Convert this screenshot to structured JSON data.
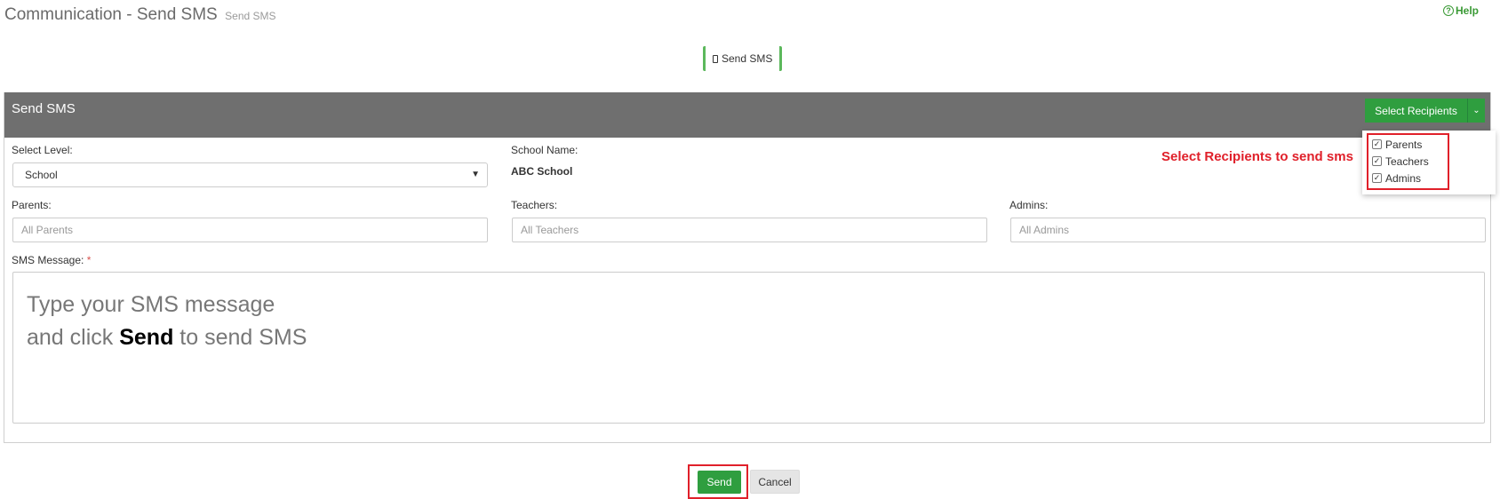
{
  "header": {
    "title": "Communication - Send SMS",
    "subtitle": "Send SMS",
    "help_label": "Help"
  },
  "tab": {
    "label": "Send SMS"
  },
  "panel": {
    "title": "Send SMS",
    "select_recipients_label": "Select Recipients"
  },
  "recipients_dropdown": {
    "items": [
      {
        "label": "Parents",
        "checked": true
      },
      {
        "label": "Teachers",
        "checked": true
      },
      {
        "label": "Admins",
        "checked": true
      }
    ]
  },
  "annotation_note": "Select Recipients to send sms",
  "form": {
    "select_level_label": "Select Level:",
    "select_level_value": "School",
    "school_name_label": "School Name:",
    "school_name_value": "ABC School",
    "parents_label": "Parents:",
    "parents_placeholder": "All Parents",
    "teachers_label": "Teachers:",
    "teachers_placeholder": "All Teachers",
    "admins_label": "Admins:",
    "admins_placeholder": "All Admins",
    "sms_message_label": "SMS Message:",
    "required_marker": "*",
    "message_line1": "Type your SMS message",
    "message_line2_prefix": "and click",
    "message_line2_bold": "Send",
    "message_line2_suffix": "to send SMS"
  },
  "actions": {
    "send_label": "Send",
    "cancel_label": "Cancel"
  },
  "colors": {
    "accent_green": "#2f9e3f",
    "panel_heading": "#6f6f6f",
    "annotation_red": "#e0202a"
  }
}
